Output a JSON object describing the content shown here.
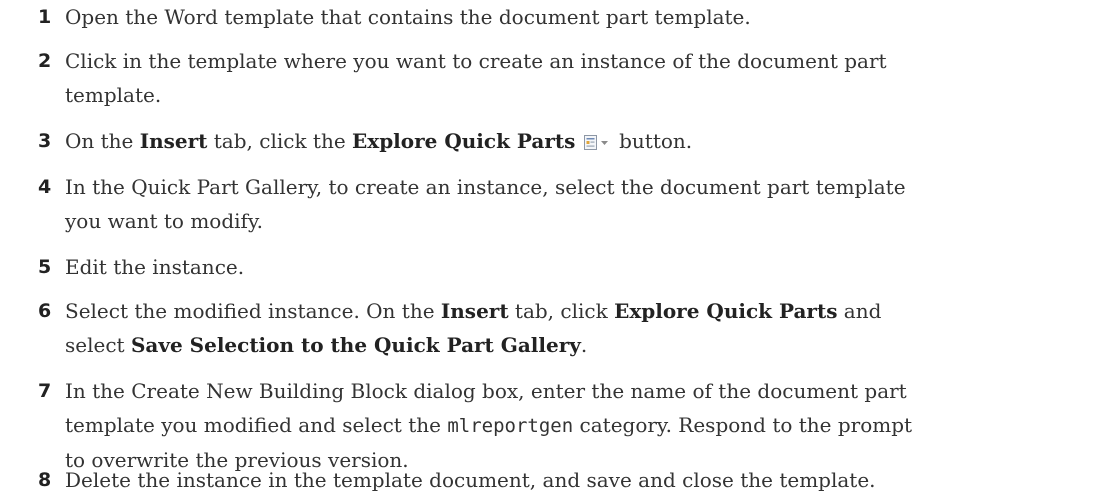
{
  "steps": [
    {
      "number": "1",
      "text": "Open the Word template that contains the document part template."
    },
    {
      "number": "2",
      "line1": "Click in the template where you want to create an instance of the document part",
      "line2": "template."
    },
    {
      "number": "3",
      "t1": "On the ",
      "b1": "Insert",
      "t2": " tab, click the ",
      "b2": "Explore Quick Parts",
      "icon": "quick-parts-icon",
      "t3": " button."
    },
    {
      "number": "4",
      "line1": "In the Quick Part Gallery, to create an instance, select the document part template",
      "line2": "you want to modify."
    },
    {
      "number": "5",
      "text": "Edit the instance."
    },
    {
      "number": "6",
      "t1": "Select the modified instance. On the ",
      "b1": "Insert",
      "t2": " tab, click ",
      "b2": "Explore Quick Parts",
      "t3": " and",
      "t4": "select ",
      "b3": "Save Selection to the Quick Part Gallery",
      "t5": "."
    },
    {
      "number": "7",
      "line1": "In the Create New Building Block dialog box, enter the name of the document part",
      "l2a": "template you modified and select the ",
      "code": "mlreportgen",
      "l2b": " category. Respond to the prompt",
      "line3": "to overwrite the previous version."
    },
    {
      "number": "8",
      "text": "Delete the instance in the template document, and save and close the template."
    }
  ]
}
